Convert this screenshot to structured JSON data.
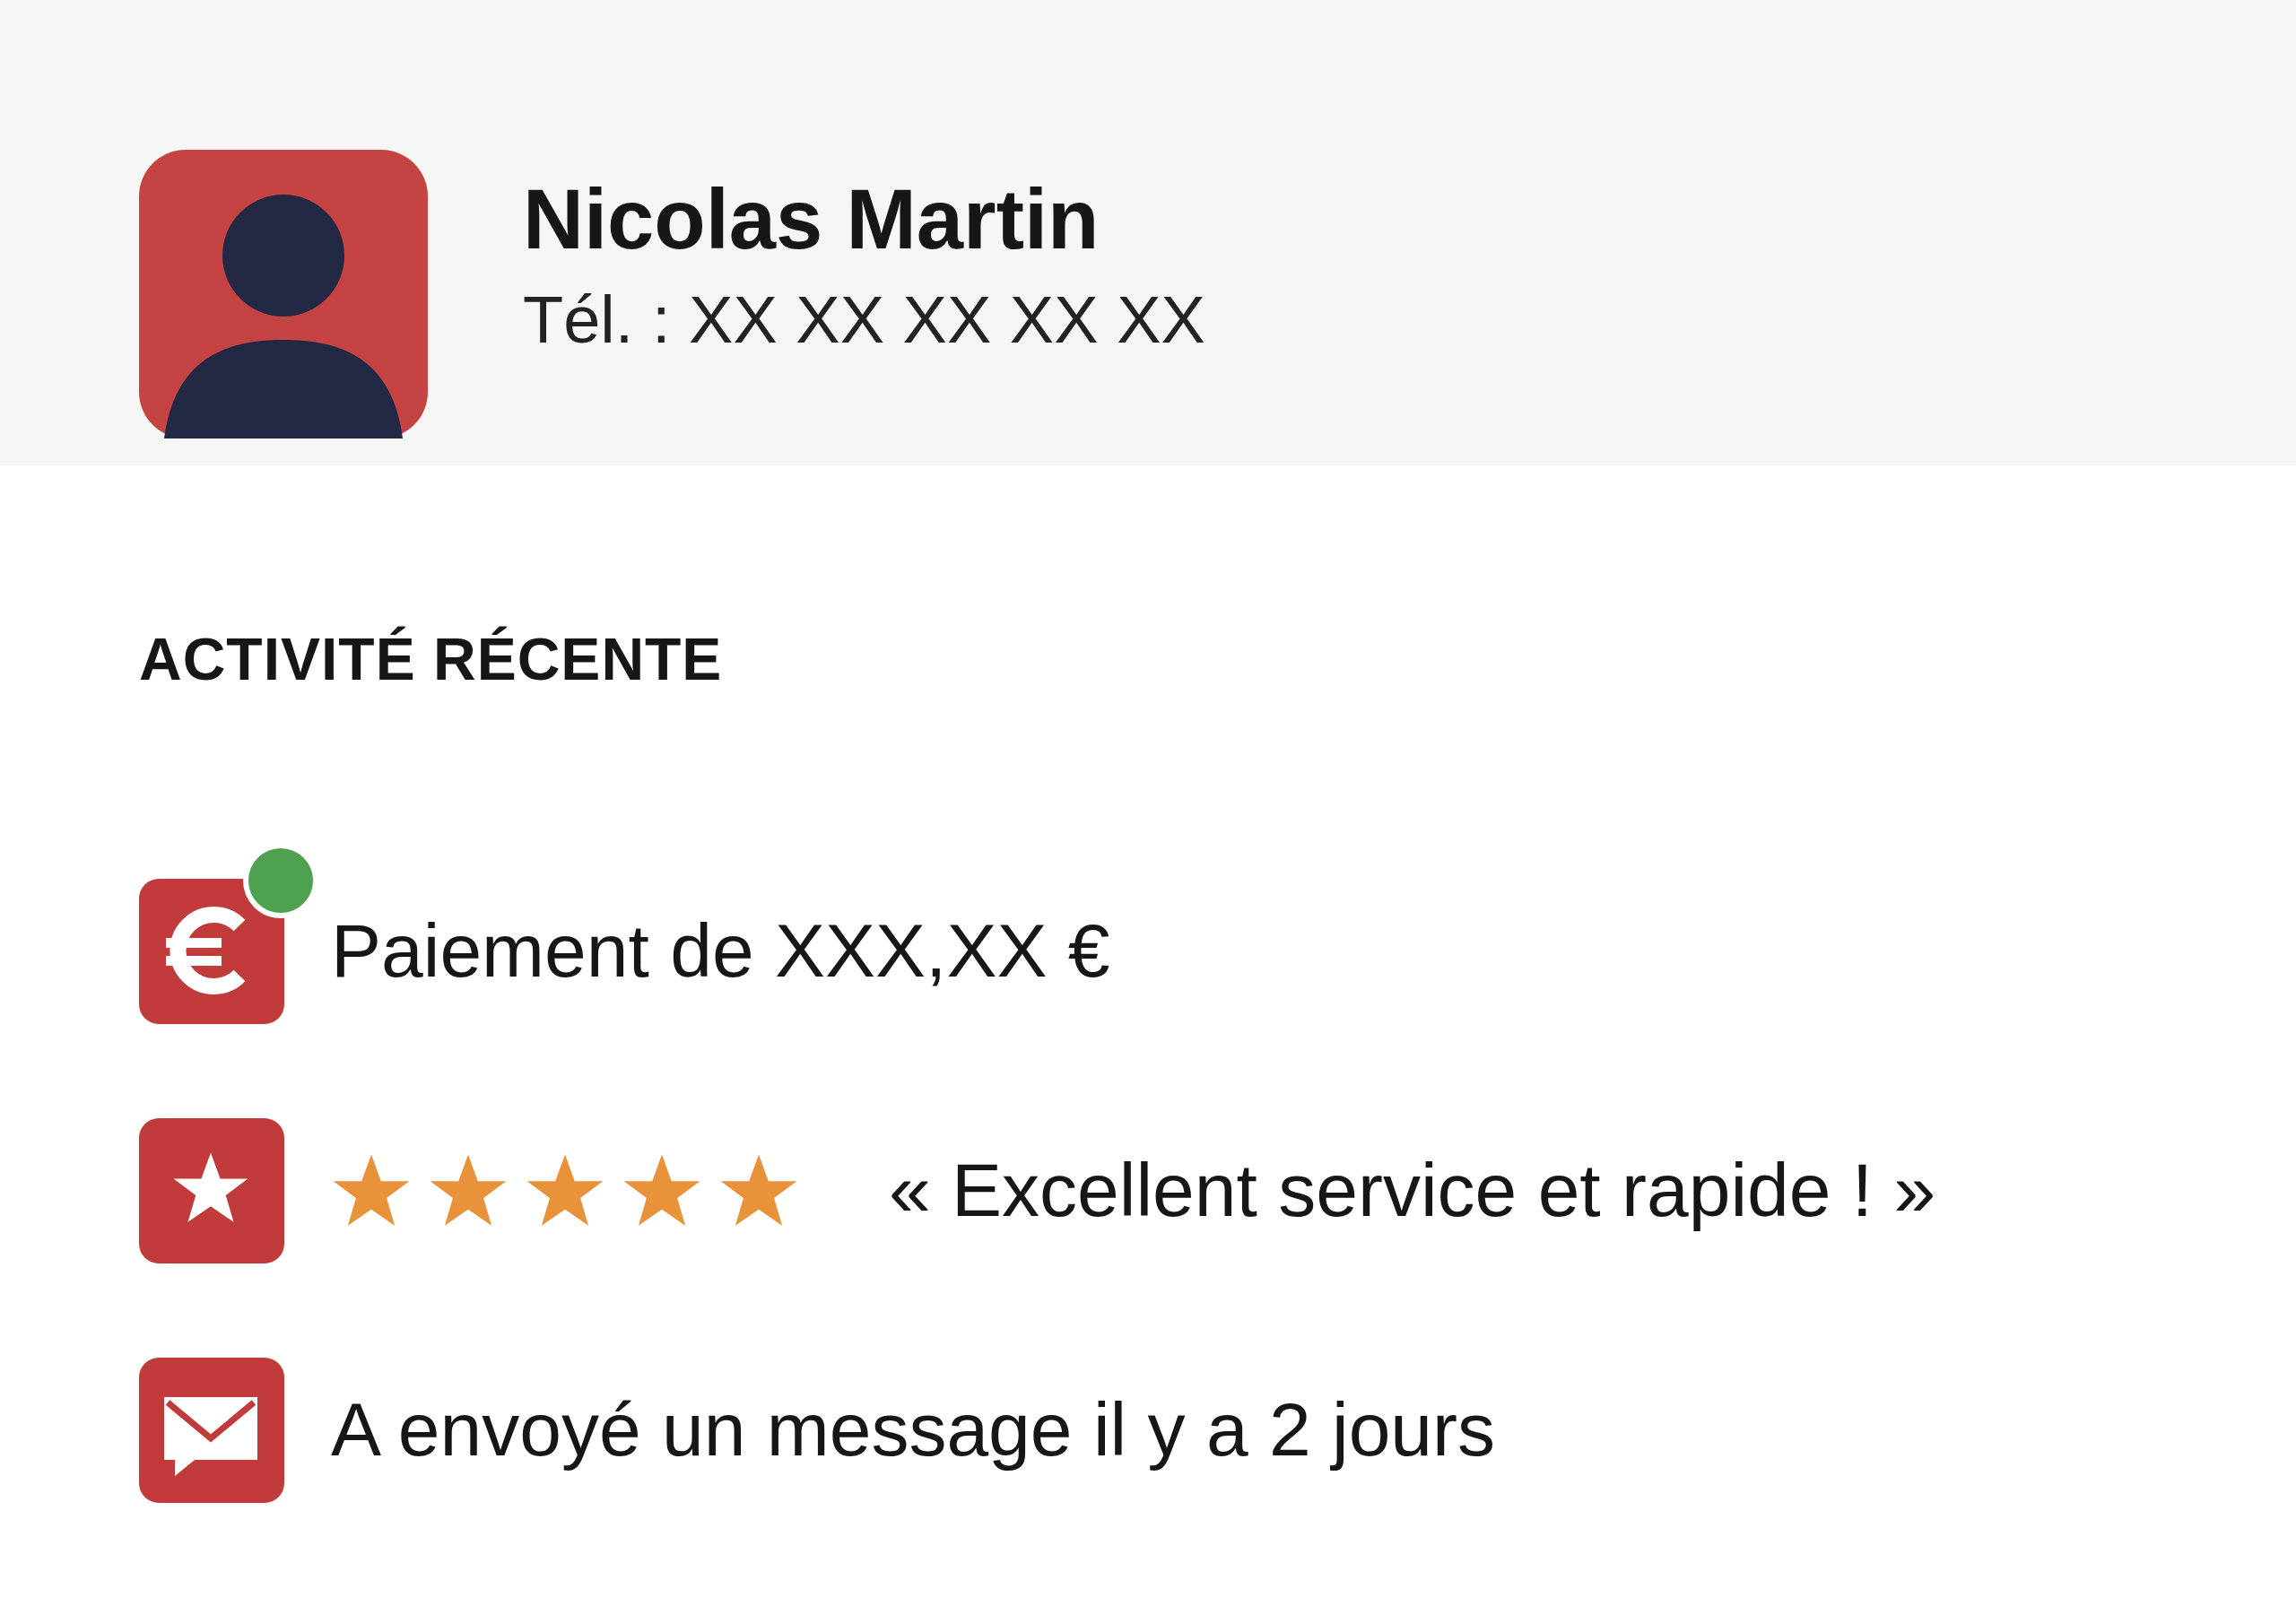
{
  "profile": {
    "name": "Nicolas Martin",
    "phone": "Tél. : XX XX XX XX XX"
  },
  "section_title": "ACTIVITÉ RÉCENTE",
  "activities": [
    {
      "kind": "payment",
      "text": "Paiement de XXX,XX €",
      "new": true
    },
    {
      "kind": "review",
      "stars": 5,
      "text": "« Excellent service et rapide ! »",
      "new": false
    },
    {
      "kind": "message",
      "text": "A envoyé un message il y a 2 jours",
      "new": false
    }
  ]
}
